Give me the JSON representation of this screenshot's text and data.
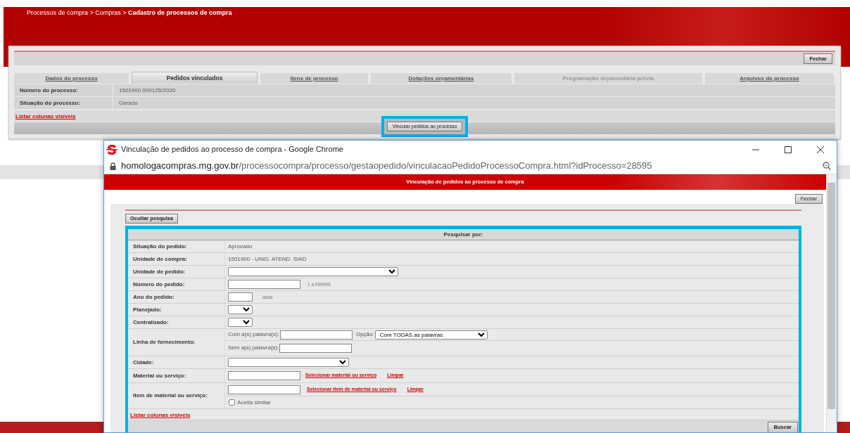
{
  "breadcrumb": "Processos de compra > Compras > **Cadastro de processos de compra**",
  "process_panel": {
    "close_button": "Fechar",
    "tabs": [
      {
        "label": "Dados do processo",
        "selected": false,
        "disabled": false
      },
      {
        "label": "Pedidos vinculados",
        "selected": true,
        "disabled": false
      },
      {
        "label": "Itens de processo",
        "selected": false,
        "disabled": false
      },
      {
        "label": "Dotações orçamentárias",
        "selected": false,
        "disabled": false
      },
      {
        "label": "Programação orçamentária prévia",
        "selected": false,
        "disabled": true
      },
      {
        "label": "Arquivos do processo",
        "selected": false,
        "disabled": false
      }
    ],
    "fields": [
      {
        "label": "Número do processo:",
        "value": "1501900 000125/2020"
      },
      {
        "label": "Situação do processo:",
        "value": "Gerado"
      }
    ],
    "list_columns_link": "Listar colunas visíveis",
    "action_button": {
      "label": "Vincular pedidos ao processo",
      "highlighted": true
    }
  },
  "popup_window": {
    "title": "Vinculação de pedidos ao processo de compra - Google Chrome",
    "url": {
      "host": "homologacompras.mg.gov.br",
      "path": "/processocompra/processo/gestaopedido/vinculacaoPedidoProcessoCompra.html?idProcesso=28595"
    },
    "page_title": "Vinculação de pedidos ao processo de compra",
    "close_button": "Fechar",
    "toggle_search_button": "Ocultar pesquisa",
    "search": {
      "heading": "Pesquisar por:",
      "highlighted": true,
      "rows": [
        {
          "kind": "text",
          "label": "Situação do pedido:",
          "value": "Aprovado"
        },
        {
          "kind": "text",
          "label": "Unidade de compra:",
          "value": "1501900 -  UNID. ATEND. SIAD"
        },
        {
          "kind": "select",
          "label": "Unidade de pedido:"
        },
        {
          "kind": "input",
          "label": "Número do pedido:",
          "hint": "1 a 999999"
        },
        {
          "kind": "input",
          "label": "Ano do pedido:",
          "hint": "aaaa"
        },
        {
          "kind": "select",
          "label": "Planejado:"
        },
        {
          "kind": "select",
          "label": "Centralizado:"
        },
        {
          "kind": "words",
          "label": "Linha de fornecimento:",
          "with_label": "Com a(s) palavra(s):",
          "option_label": "Opção:",
          "option_value": "Com TODAS as palavras",
          "without_label": "Sem a(s) palavra(s):"
        },
        {
          "kind": "select",
          "label": "Cidade:"
        },
        {
          "kind": "lookup",
          "label": "Material ou serviço:",
          "select_link": "Selecionar material ou serviço",
          "clear_link": "Limpar"
        },
        {
          "kind": "lookup",
          "label": "Item de material ou serviço:",
          "select_link": "Selecionar item de material ou serviço",
          "clear_link": "Limpar",
          "checkbox": {
            "label": "Aceita similar",
            "checked": false
          }
        }
      ],
      "list_columns_link": "Listar colunas visíveis",
      "search_button": "Buscar"
    }
  }
}
